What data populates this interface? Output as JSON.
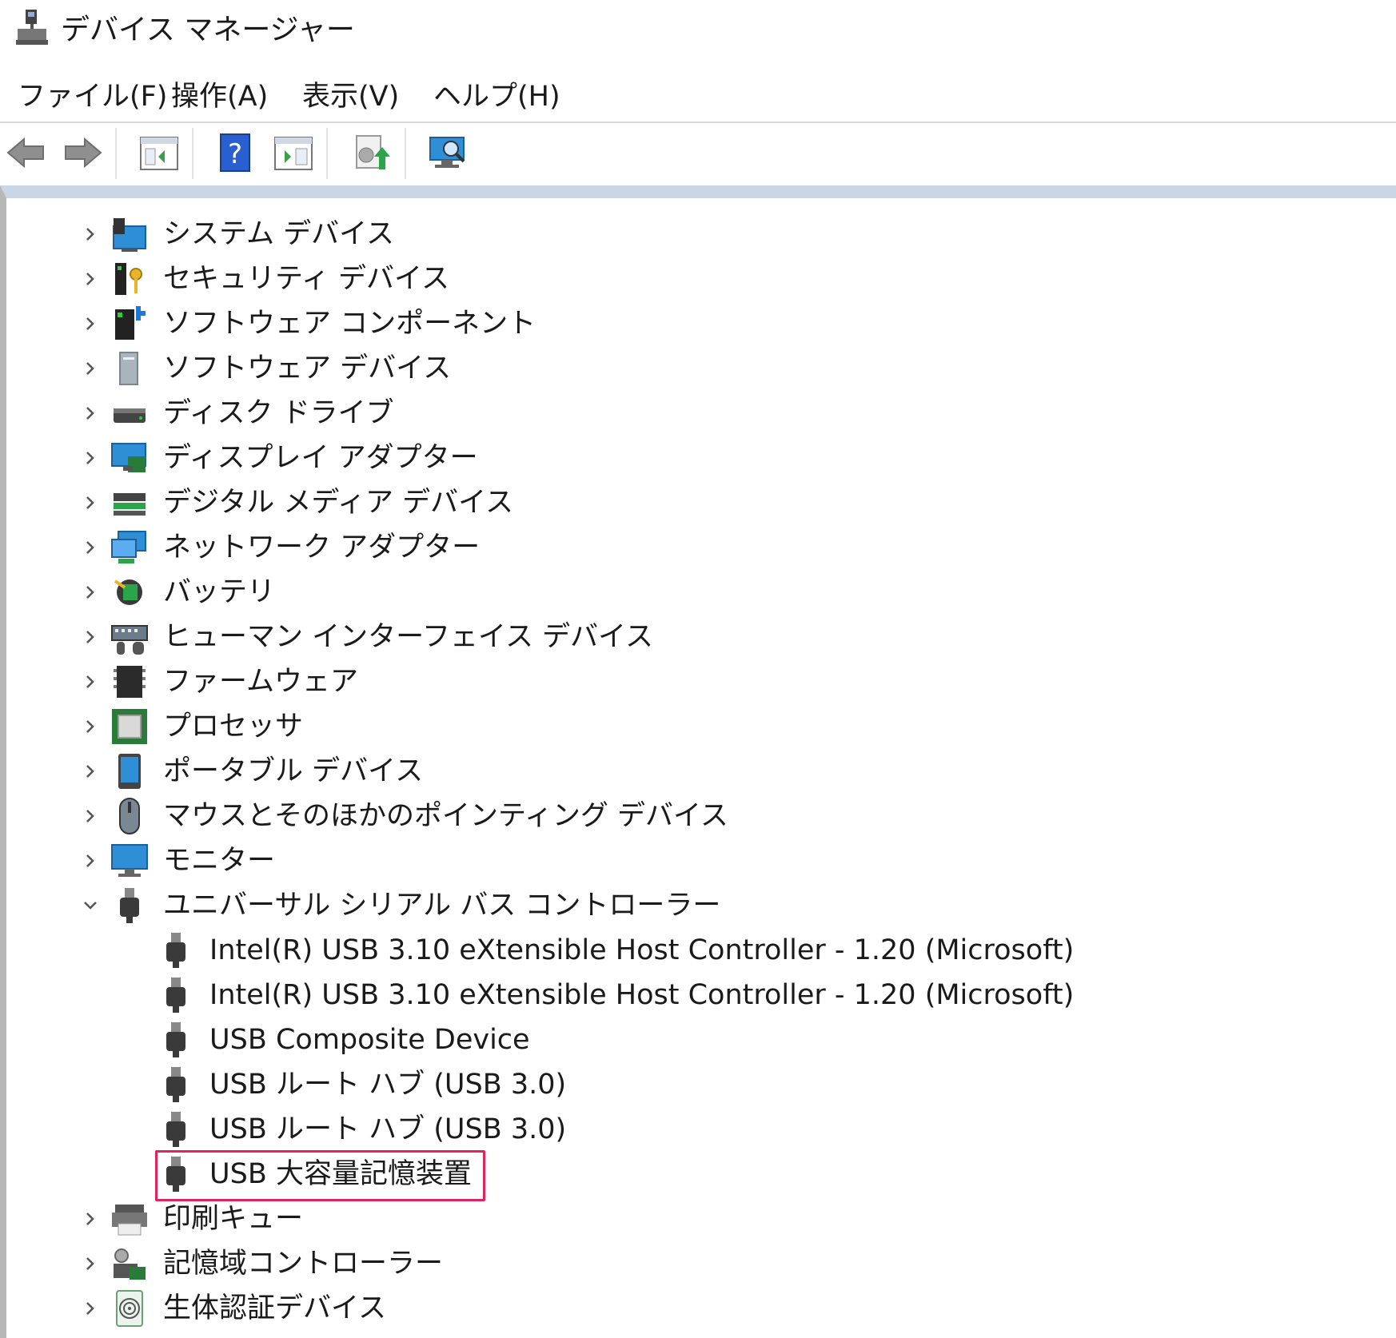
{
  "window": {
    "title": "デバイス マネージャー"
  },
  "menu": {
    "file": "ファイル(F)",
    "action": "操作(A)",
    "view": "表示(V)",
    "help": "ヘルプ(H)"
  },
  "toolbar": {
    "icons": [
      "back-arrow-icon",
      "forward-arrow-icon",
      "show-hide-console-tree-icon",
      "help-icon",
      "show-action-pane-icon",
      "update-driver-icon",
      "scan-hardware-changes-icon"
    ]
  },
  "colors": {
    "highlight": "#e0245e",
    "pane_top": "#c8d6e6"
  },
  "tree": {
    "items": [
      {
        "label": "システム デバイス",
        "icon": "system-devices-icon",
        "expanded": false
      },
      {
        "label": "セキュリティ デバイス",
        "icon": "security-devices-icon",
        "expanded": false
      },
      {
        "label": "ソフトウェア コンポーネント",
        "icon": "software-component-icon",
        "expanded": false
      },
      {
        "label": "ソフトウェア デバイス",
        "icon": "software-device-icon",
        "expanded": false
      },
      {
        "label": "ディスク ドライブ",
        "icon": "disk-drive-icon",
        "expanded": false
      },
      {
        "label": "ディスプレイ アダプター",
        "icon": "display-adapter-icon",
        "expanded": false
      },
      {
        "label": "デジタル メディア デバイス",
        "icon": "digital-media-icon",
        "expanded": false
      },
      {
        "label": "ネットワーク アダプター",
        "icon": "network-adapter-icon",
        "expanded": false
      },
      {
        "label": "バッテリ",
        "icon": "battery-icon",
        "expanded": false
      },
      {
        "label": "ヒューマン インターフェイス デバイス",
        "icon": "hid-icon",
        "expanded": false
      },
      {
        "label": "ファームウェア",
        "icon": "firmware-icon",
        "expanded": false
      },
      {
        "label": "プロセッサ",
        "icon": "processor-icon",
        "expanded": false
      },
      {
        "label": "ポータブル デバイス",
        "icon": "portable-device-icon",
        "expanded": false
      },
      {
        "label": "マウスとそのほかのポインティング デバイス",
        "icon": "mouse-icon",
        "expanded": false
      },
      {
        "label": "モニター",
        "icon": "monitor-icon",
        "expanded": false
      },
      {
        "label": "ユニバーサル シリアル バス コントローラー",
        "icon": "usb-icon",
        "expanded": true
      }
    ],
    "usb_children": [
      "Intel(R) USB 3.10 eXtensible Host Controller - 1.20 (Microsoft)",
      "Intel(R) USB 3.10 eXtensible Host Controller - 1.20 (Microsoft)",
      "USB Composite Device",
      "USB ルート ハブ (USB 3.0)",
      "USB ルート ハブ (USB 3.0)",
      "USB 大容量記憶装置"
    ],
    "after_items": [
      {
        "label": "印刷キュー",
        "icon": "print-queue-icon",
        "expanded": false
      },
      {
        "label": "記憶域コントローラー",
        "icon": "storage-controller-icon",
        "expanded": false
      },
      {
        "label": "生体認証デバイス",
        "icon": "biometric-device-icon",
        "expanded": false
      }
    ]
  }
}
